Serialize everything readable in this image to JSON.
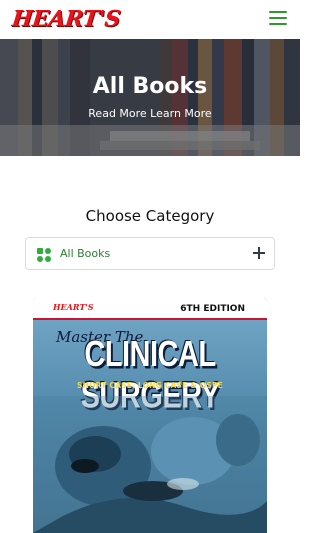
{
  "header": {
    "logo_text": "HEART'S",
    "menu_icon": "hamburger-menu-icon",
    "brand_color": "#e8141b",
    "accent_color": "#2e9a2e"
  },
  "hero": {
    "title": "All Books",
    "subtitle": "Read More Learn More"
  },
  "category": {
    "heading": "Choose Category",
    "selected_label": "All Books",
    "icon": "category-grid-icon",
    "expand_icon": "plus-icon"
  },
  "book": {
    "logo_text": "HEART'S",
    "edition": "6TH EDITION",
    "series": "Master The",
    "title": "CLINICAL SURGERY",
    "subtitle": "SHORT CASE, LONG CASE & OSPE"
  }
}
